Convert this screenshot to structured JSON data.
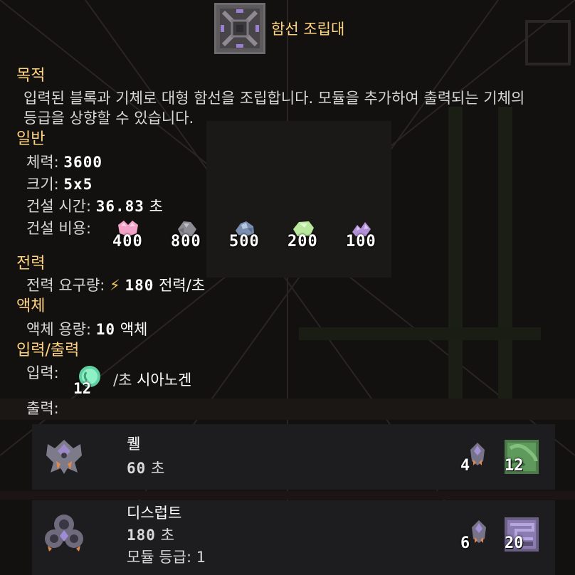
{
  "block": {
    "name": "함선 조립대",
    "icon": "ship-assembler-icon"
  },
  "colors": {
    "accent": "#ffd37f",
    "text": "#d8d8d8",
    "card_bg": "#1d1d1f",
    "power": "#f3c35c"
  },
  "sections": {
    "purpose": {
      "heading": "목적",
      "description": "입력된 블록과 기체로 대형 함선을 조립합니다. 모듈을 추가하여 출력되는 기체의 등급을 상향할 수 있습니다."
    },
    "general": {
      "heading": "일반",
      "health_label": "체력:",
      "health_value": "3600",
      "size_label": "크기:",
      "size_value": "5x5",
      "build_time_label": "건설 시간:",
      "build_time_value": "36.83",
      "build_time_unit": "초",
      "build_cost_label": "건설 비용:",
      "build_cost": [
        {
          "icon": "pink-crystal-icon",
          "amount": "400"
        },
        {
          "icon": "gray-ore-icon",
          "amount": "800"
        },
        {
          "icon": "blue-ore-icon",
          "amount": "500"
        },
        {
          "icon": "green-crystal-icon",
          "amount": "200"
        },
        {
          "icon": "purple-crystal-icon",
          "amount": "100"
        }
      ]
    },
    "power": {
      "heading": "전력",
      "usage_label": "전력 요구량:",
      "usage_icon": "lightning-icon",
      "usage_value": "180",
      "usage_unit": "전력/초"
    },
    "liquid": {
      "heading": "액체",
      "capacity_label": "액체 용량:",
      "capacity_value": "10",
      "capacity_unit": "액체"
    },
    "io": {
      "heading": "입력/출력",
      "input_label": "입력:",
      "input_amount": "12",
      "input_icon": "cyanogen-icon",
      "input_rate": "/초",
      "input_name": "시아노겐",
      "output_label": "출력:"
    }
  },
  "outputs": [
    {
      "name": "퀠",
      "time_value": "60",
      "time_unit": "초",
      "module_tier": "",
      "unit_icon": "quell-unit-icon",
      "requirements": [
        {
          "icon": "small-unit-icon",
          "amount": "4"
        },
        {
          "icon": "green-block-icon",
          "amount": "12"
        }
      ]
    },
    {
      "name": "디스럽트",
      "time_value": "180",
      "time_unit": "초",
      "module_tier": "모듈 등급: 1",
      "unit_icon": "disrupt-unit-icon",
      "requirements": [
        {
          "icon": "small-unit-icon",
          "amount": "6"
        },
        {
          "icon": "purple-block-icon",
          "amount": "20"
        }
      ]
    }
  ]
}
